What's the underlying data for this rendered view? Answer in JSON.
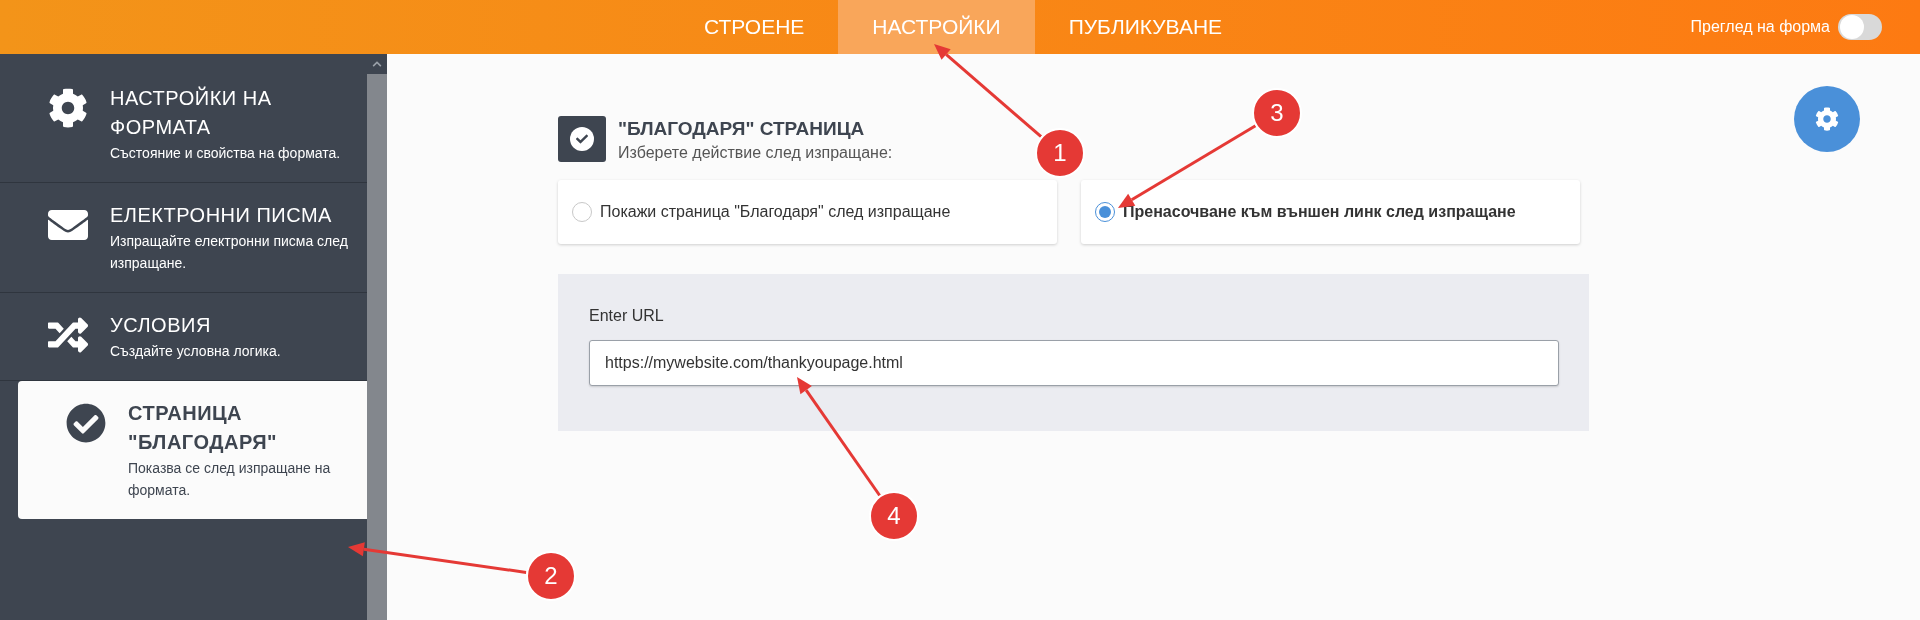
{
  "top_nav": {
    "tabs": [
      {
        "label": "СТРОЕНЕ",
        "selected": false
      },
      {
        "label": "НАСТРОЙКИ",
        "selected": true
      },
      {
        "label": "ПУБЛИКУВАНЕ",
        "selected": false
      }
    ],
    "preview_toggle": {
      "label": "Преглед на форма",
      "on": false
    }
  },
  "sidebar": {
    "items": [
      {
        "title": "НАСТРОЙКИ НА ФОРМАТА",
        "subtitle": "Състояние и свойства на формата.",
        "selected": false
      },
      {
        "title": "ЕЛЕКТРОННИ ПИСМА",
        "subtitle": "Изпращайте електронни писма след изпращане.",
        "selected": false
      },
      {
        "title": "УСЛОВИЯ",
        "subtitle": "Създайте условна логика.",
        "selected": false
      },
      {
        "title": "СТРАНИЦА \"БЛАГОДАРЯ\"",
        "subtitle": "Показва се след изпращане на формата.",
        "selected": true
      }
    ]
  },
  "section": {
    "title": "\"БЛАГОДАРЯ\" СТРАНИЦА",
    "subtitle": "Изберете действие след изпращане:",
    "options": [
      {
        "label": "Покажи страница \"Благодаря\" след изпращане",
        "selected": false
      },
      {
        "label": "Пренасочване към външен линк след изпращане",
        "selected": true
      }
    ],
    "url_field": {
      "label": "Enter URL",
      "value": "https://mywebsite.com/thankyoupage.html"
    }
  },
  "annotations": [
    {
      "number": "1"
    },
    {
      "number": "2"
    },
    {
      "number": "3"
    },
    {
      "number": "4"
    }
  ]
}
